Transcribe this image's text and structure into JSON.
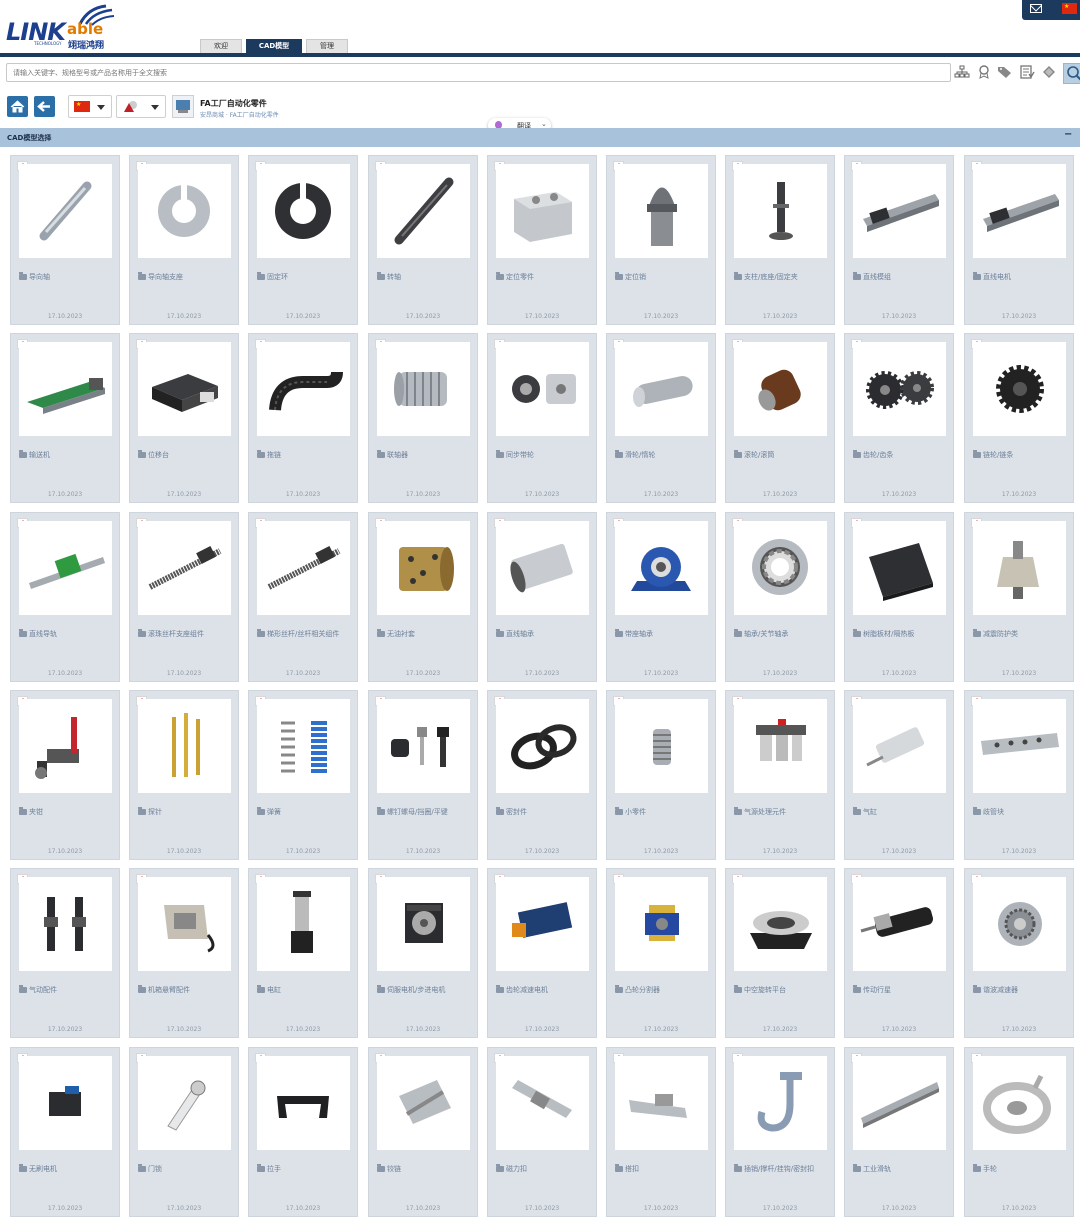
{
  "header": {
    "logo_main": "LINK",
    "logo_accent": "able",
    "logo_cn": "翊瑞鸿翔",
    "logo_tagline": "TECHNOLOGY",
    "tabs": [
      {
        "label": "欢迎",
        "active": false
      },
      {
        "label": "CAD模型",
        "active": true
      },
      {
        "label": "管理",
        "active": false
      }
    ]
  },
  "search": {
    "placeholder": "请输入关键字、规格型号或产品名称用于全文搜索",
    "tool_icons": [
      "hierarchy-icon",
      "certificate-icon",
      "tags-icon",
      "checklist-icon",
      "puzzle-icon"
    ]
  },
  "nav": {
    "category_title": "FA工厂自动化零件",
    "breadcrumb": "安昂商城 · FA工厂自动化零件",
    "translate_label": "翻译"
  },
  "section": {
    "title": "CAD模型选择",
    "collapse_symbol": "−"
  },
  "colors": {
    "brand_dark": "#1c3a5e",
    "section_bar": "#a9c2dc",
    "card_bg": "#dde2e8",
    "nav_button": "#2a6fa8"
  },
  "items": [
    {
      "name": "导向轴",
      "date": "17.10.2023",
      "icon": "shaft"
    },
    {
      "name": "导向轴支座",
      "date": "17.10.2023",
      "icon": "ring"
    },
    {
      "name": "固定环",
      "date": "17.10.2023",
      "icon": "darkring"
    },
    {
      "name": "转轴",
      "date": "17.10.2023",
      "icon": "darkshaft"
    },
    {
      "name": "定位零件",
      "date": "17.10.2023",
      "icon": "block"
    },
    {
      "name": "定位销",
      "date": "17.10.2023",
      "icon": "pin"
    },
    {
      "name": "支柱/底座/固定夹",
      "date": "17.10.2023",
      "icon": "post"
    },
    {
      "name": "直线模组",
      "date": "17.10.2023",
      "icon": "rail"
    },
    {
      "name": "直线电机",
      "date": "17.10.2023",
      "icon": "rail"
    },
    {
      "name": "输送机",
      "date": "17.10.2023",
      "icon": "conveyor"
    },
    {
      "name": "位移台",
      "date": "17.10.2023",
      "icon": "stage"
    },
    {
      "name": "拖链",
      "date": "17.10.2023",
      "icon": "chain"
    },
    {
      "name": "联轴器",
      "date": "17.10.2023",
      "icon": "coupling"
    },
    {
      "name": "同步带轮",
      "date": "17.10.2023",
      "icon": "pulley"
    },
    {
      "name": "滑轮/惰轮",
      "date": "17.10.2023",
      "icon": "roller"
    },
    {
      "name": "滚轮/滚筒",
      "date": "17.10.2023",
      "icon": "wheel"
    },
    {
      "name": "齿轮/齿条",
      "date": "17.10.2023",
      "icon": "gear"
    },
    {
      "name": "链轮/链条",
      "date": "17.10.2023",
      "icon": "sprocket"
    },
    {
      "name": "直线导轨",
      "date": "17.10.2023",
      "icon": "guide"
    },
    {
      "name": "滚珠丝杆支座组件",
      "date": "17.10.2023",
      "icon": "screw"
    },
    {
      "name": "梯形丝杆/丝杆相关组件",
      "date": "17.10.2023",
      "icon": "screw"
    },
    {
      "name": "无油衬套",
      "date": "17.10.2023",
      "icon": "bushing"
    },
    {
      "name": "直线轴承",
      "date": "17.10.2023",
      "icon": "bearing"
    },
    {
      "name": "带座轴承",
      "date": "17.10.2023",
      "icon": "pillow"
    },
    {
      "name": "轴承/关节轴承",
      "date": "17.10.2023",
      "icon": "ballbearing"
    },
    {
      "name": "树脂板材/隔热板",
      "date": "17.10.2023",
      "icon": "plate"
    },
    {
      "name": "减震防护类",
      "date": "17.10.2023",
      "icon": "damper"
    },
    {
      "name": "夹钳",
      "date": "17.10.2023",
      "icon": "clamp"
    },
    {
      "name": "探针",
      "date": "17.10.2023",
      "icon": "probe"
    },
    {
      "name": "弹簧",
      "date": "17.10.2023",
      "icon": "spring"
    },
    {
      "name": "螺钉螺母/挡圈/平键",
      "date": "17.10.2023",
      "icon": "screws"
    },
    {
      "name": "密封件",
      "date": "17.10.2023",
      "icon": "seal"
    },
    {
      "name": "小零件",
      "date": "17.10.2023",
      "icon": "bellows"
    },
    {
      "name": "气源处理元件",
      "date": "17.10.2023",
      "icon": "frl"
    },
    {
      "name": "气缸",
      "date": "17.10.2023",
      "icon": "cylinder"
    },
    {
      "name": "歧管块",
      "date": "17.10.2023",
      "icon": "manifold"
    },
    {
      "name": "气动配件",
      "date": "17.10.2023",
      "icon": "absorber"
    },
    {
      "name": "机箱悬臂配件",
      "date": "17.10.2023",
      "icon": "housing"
    },
    {
      "name": "电缸",
      "date": "17.10.2023",
      "icon": "actuator"
    },
    {
      "name": "伺服电机/步进电机",
      "date": "17.10.2023",
      "icon": "stepper"
    },
    {
      "name": "齿轮减速电机",
      "date": "17.10.2023",
      "icon": "gearmotor"
    },
    {
      "name": "凸轮分割器",
      "date": "17.10.2023",
      "icon": "indexer"
    },
    {
      "name": "中空旋转平台",
      "date": "17.10.2023",
      "icon": "rotary"
    },
    {
      "name": "传动行星",
      "date": "17.10.2023",
      "icon": "planetary"
    },
    {
      "name": "谐波减速器",
      "date": "17.10.2023",
      "icon": "harmonic"
    },
    {
      "name": "无刷电机",
      "date": "17.10.2023",
      "icon": "bldc"
    },
    {
      "name": "门锁",
      "date": "17.10.2023",
      "icon": "lock"
    },
    {
      "name": "拉手",
      "date": "17.10.2023",
      "icon": "handle"
    },
    {
      "name": "铰链",
      "date": "17.10.2023",
      "icon": "hinge"
    },
    {
      "name": "磁力扣",
      "date": "17.10.2023",
      "icon": "magnet"
    },
    {
      "name": "搭扣",
      "date": "17.10.2023",
      "icon": "latch"
    },
    {
      "name": "插销/撑杆/挂钩/密封扣",
      "date": "17.10.2023",
      "icon": "hook"
    },
    {
      "name": "工业滑轨",
      "date": "17.10.2023",
      "icon": "slide"
    },
    {
      "name": "手轮",
      "date": "17.10.2023",
      "icon": "handwheel"
    }
  ]
}
